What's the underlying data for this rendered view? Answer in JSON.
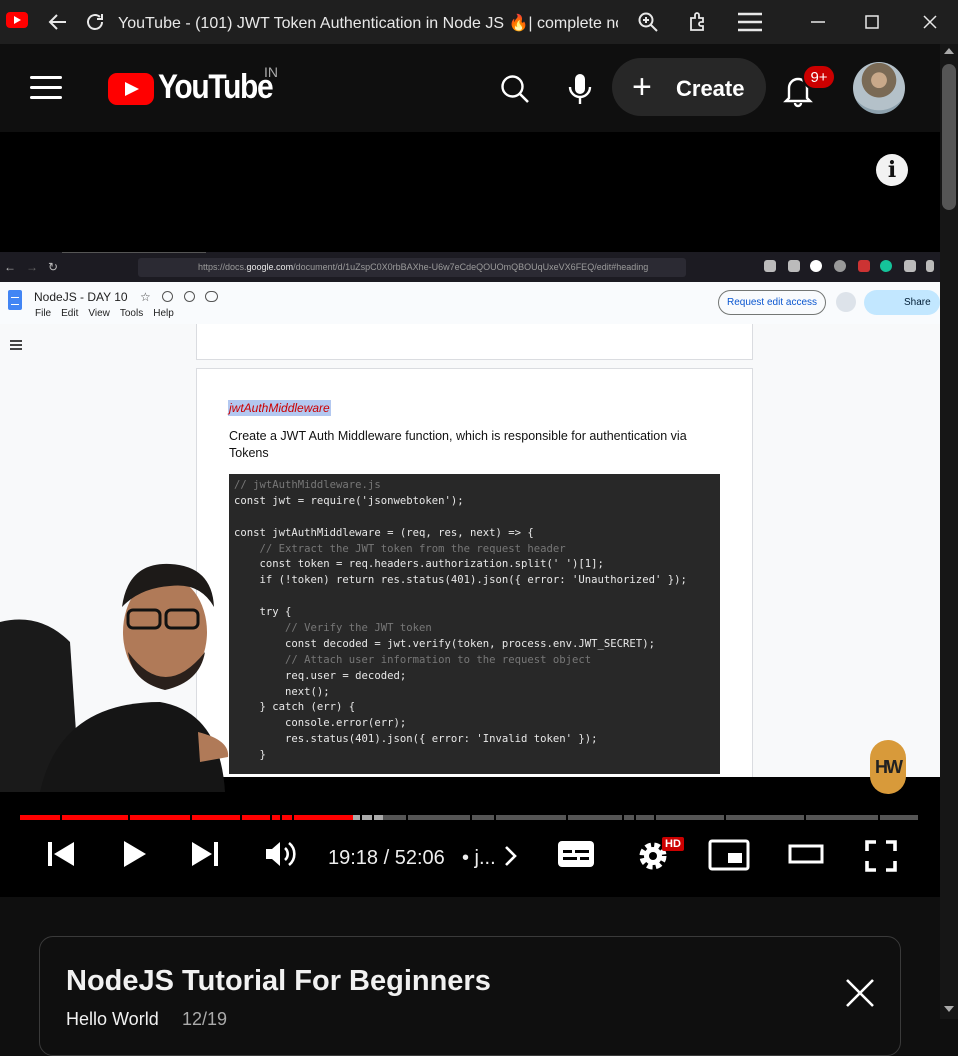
{
  "browser": {
    "tab_title": "YouTube - (101) JWT Token Authentication in Node JS 🔥| complete no..."
  },
  "masthead": {
    "logo_text": "YouTube",
    "country_code": "IN",
    "create_label": "Create",
    "notification_count": "9+"
  },
  "video": {
    "info_symbol": "i",
    "recording": {
      "url_prefix": "https://docs.",
      "url_domain": "google.com",
      "url_rest": "/document/d/1uZspC0X0rbBAXhe-U6w7eCdeQOUOmQBOUqUxeVX6FEQ/edit#heading",
      "doc_title": "NodeJS - DAY 10",
      "doc_menu": [
        "File",
        "Edit",
        "View",
        "Tools",
        "Help"
      ],
      "request_edit_label": "Request edit access",
      "share_label": "Share",
      "heading": "jwtAuthMiddleware",
      "paragraph": "Create a JWT Auth Middleware function, which is responsible for authentication via Tokens",
      "code_lines": [
        "// jwtAuthMiddleware.js",
        "const jwt = require('jsonwebtoken');",
        "",
        "const jwtAuthMiddleware = (req, res, next) => {",
        "    // Extract the JWT token from the request header",
        "    const token = req.headers.authorization.split(' ')[1];",
        "    if (!token) return res.status(401).json({ error: 'Unauthorized' });",
        "",
        "    try {",
        "        // Verify the JWT token",
        "        const decoded = jwt.verify(token, process.env.JWT_SECRET);",
        "        // Attach user information to the request object",
        "        req.user = decoded;",
        "        next();",
        "    } catch (err) {",
        "        console.error(err);",
        "        res.status(401).json({ error: 'Invalid token' });",
        "    }"
      ],
      "watermark": "HW"
    },
    "player": {
      "progress_fraction": 0.37,
      "time_display": "19:18 / 52:06",
      "chapter_text": "• j...",
      "quality_badge": "HD"
    }
  },
  "playlist": {
    "title": "NodeJS Tutorial For Beginners",
    "channel": "Hello World",
    "position": "12/19"
  },
  "colors": {
    "brand_red": "#ff0000",
    "progress_played": "#f00",
    "progress_buffered": "#aaa",
    "progress_track": "#555"
  }
}
